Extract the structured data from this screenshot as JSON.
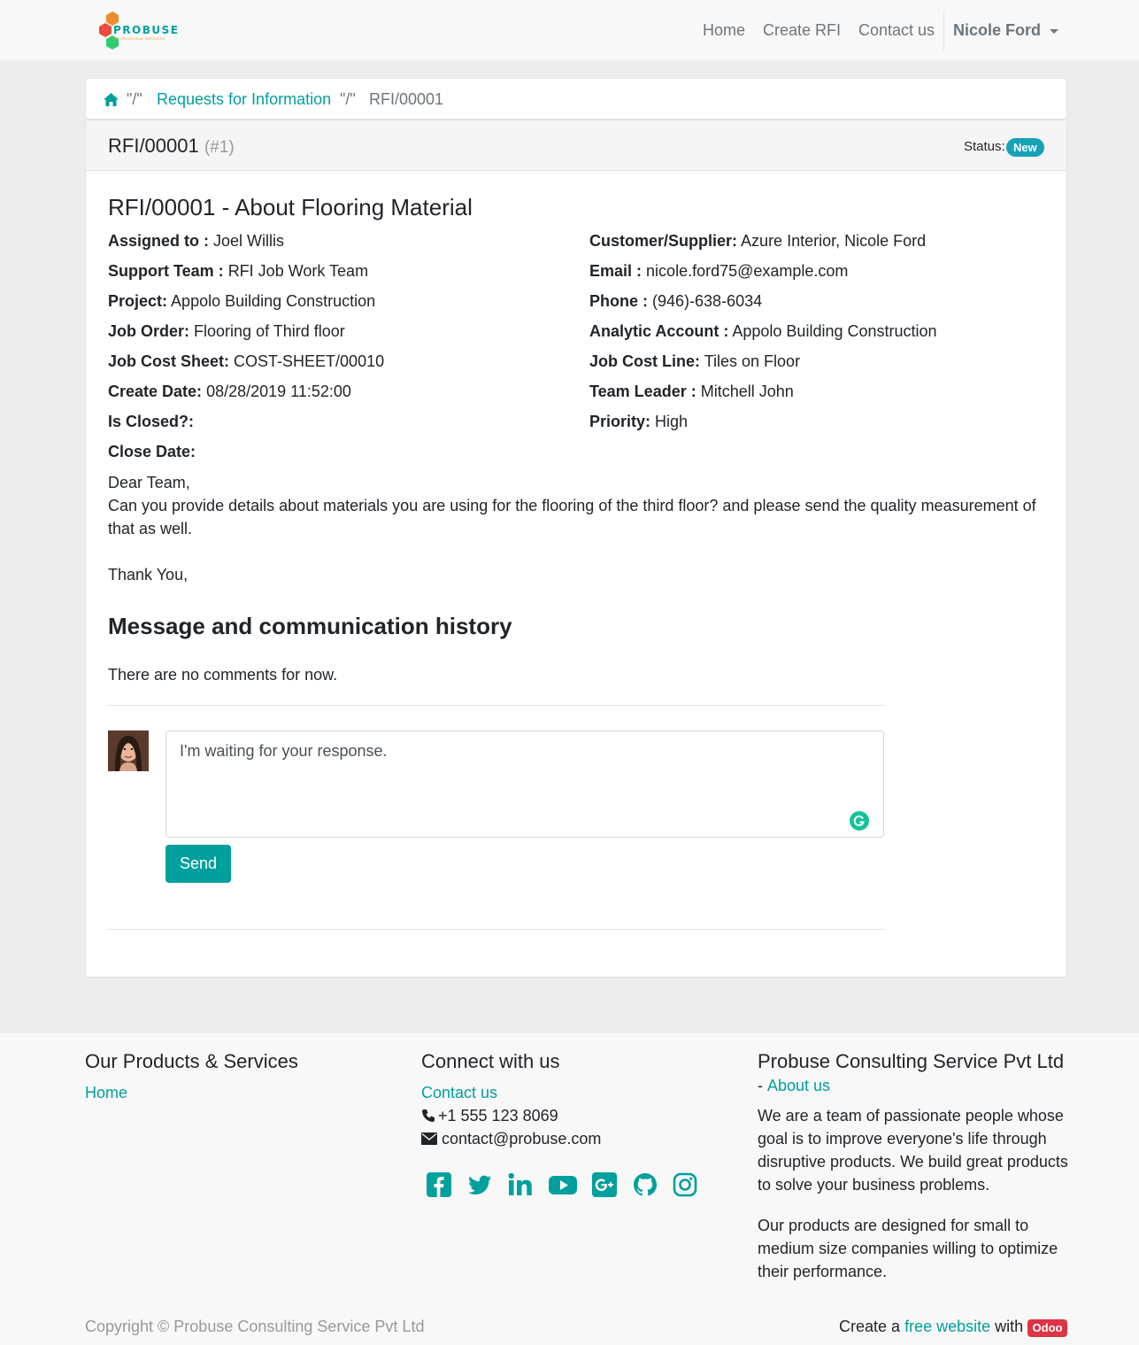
{
  "brand": {
    "logo_text": "PROBUSE",
    "logo_sub": "PROFESSIONAL BUSINESS"
  },
  "nav": {
    "home": "Home",
    "create_rfi": "Create RFI",
    "contact": "Contact us",
    "user": "Nicole Ford"
  },
  "breadcrumb": {
    "sep1": "\"/\"",
    "requests": "Requests for Information",
    "sep2": "\"/\"",
    "current": "RFI/00001"
  },
  "header": {
    "ref": "RFI/00001",
    "id": "(#1)",
    "status_label": "Status:",
    "status": "New"
  },
  "body": {
    "title": "RFI/00001 - About Flooring Material",
    "left_fields": [
      {
        "label": "Assigned to :",
        "value": "Joel Willis"
      },
      {
        "label": "Support Team :",
        "value": "RFI Job Work Team"
      },
      {
        "label": "Project:",
        "value": "Appolo Building Construction"
      },
      {
        "label": "Job Order:",
        "value": "Flooring of Third floor"
      },
      {
        "label": "Job Cost Sheet:",
        "value": "COST-SHEET/00010"
      },
      {
        "label": "Create Date:",
        "value": "08/28/2019 11:52:00"
      },
      {
        "label": "Is Closed?:",
        "value": ""
      },
      {
        "label": "Close Date:",
        "value": ""
      }
    ],
    "right_fields": [
      {
        "label": "Customer/Supplier:",
        "value": "Azure Interior, Nicole Ford"
      },
      {
        "label": "Email :",
        "value": "nicole.ford75@example.com"
      },
      {
        "label": "Phone :",
        "value": "(946)-638-6034"
      },
      {
        "label": "Analytic Account :",
        "value": "Appolo Building Construction"
      },
      {
        "label": "Job Cost Line:",
        "value": "Tiles on Floor"
      },
      {
        "label": "Team Leader :",
        "value": "Mitchell John"
      },
      {
        "label": "Priority:",
        "value": "High"
      }
    ],
    "desc_line1": "Dear Team,",
    "desc_line2": "Can you provide details about materials you are using for the flooring of the third floor? and please send the quality measurement of that as well.",
    "desc_line3": "Thank You,"
  },
  "history": {
    "title": "Message and communication history",
    "empty": "There are no comments for now.",
    "message": "I'm waiting for your response.",
    "send": "Send"
  },
  "footer": {
    "col1_title": "Our Products & Services",
    "col1_home": "Home",
    "col2_title": "Connect with us",
    "col2_contact": "Contact us",
    "phone": "+1 555 123 8069",
    "email": "contact@probuse.com",
    "col3_title": "Probuse Consulting Service Pvt Ltd",
    "col3_dash": "-",
    "col3_about": "About us",
    "para1": "We are a team of passionate people whose goal is to improve everyone's life through disruptive products. We build great products to solve your business problems.",
    "para2": "Our products are designed for small to medium size companies willing to optimize their performance.",
    "copyright": "Copyright © Probuse Consulting Service Pvt Ltd",
    "create_a": "Create a",
    "free_website": "free website",
    "with": "with",
    "odoo": "Odoo"
  },
  "colors": {
    "accent": "#00a09d",
    "status_badge": "#17a2b8",
    "odoo_red": "#dc3545"
  },
  "icons": [
    "home-icon",
    "phone-icon",
    "envelope-icon",
    "facebook-icon",
    "twitter-icon",
    "linkedin-icon",
    "youtube-icon",
    "google-plus-icon",
    "github-icon",
    "instagram-icon",
    "grammarly-icon"
  ]
}
